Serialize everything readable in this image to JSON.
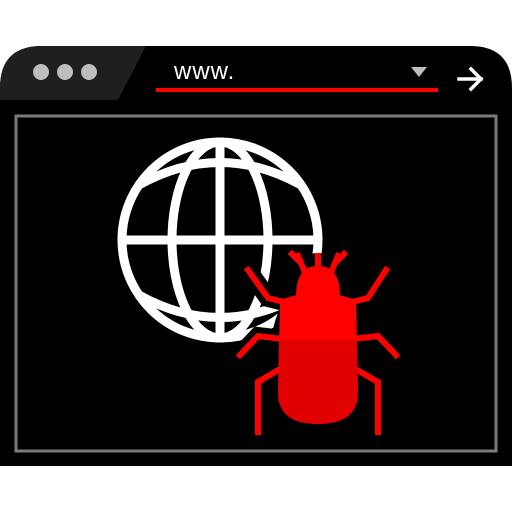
{
  "window": {
    "address_bar": {
      "url_text": "www."
    }
  },
  "colors": {
    "frame": "#000000",
    "titlebar": "#1f1f1f",
    "dots": "#bdbdbd",
    "accent": "#ff0000",
    "accent_dark": "#e00000",
    "inner_border": "#7a7a7a",
    "icon_lines": "#ffffff"
  },
  "icons": {
    "dots": "window-control-dots",
    "dropdown": "dropdown-triangle-icon",
    "go": "arrow-right-icon",
    "globe": "globe-icon",
    "bug": "bug-icon"
  }
}
